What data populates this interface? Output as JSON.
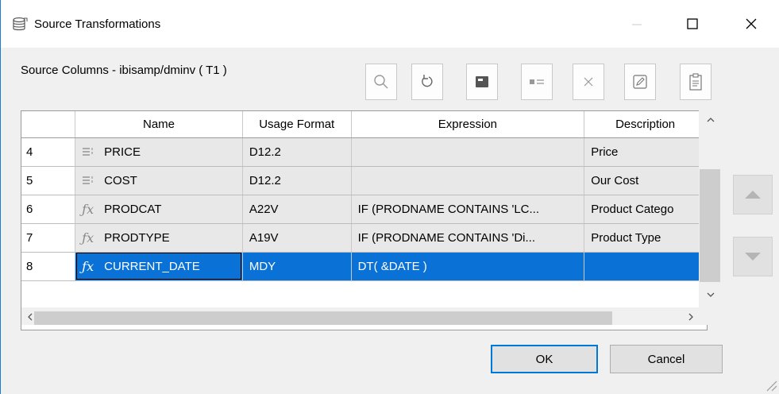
{
  "window": {
    "title": "Source Transformations",
    "icon": "database-icon"
  },
  "section_label": "Source Columns - ibisamp/dminv ( T1 )",
  "toolbar": [
    {
      "name": "search-button",
      "icon": "magnifier-icon"
    },
    {
      "name": "refresh-button",
      "icon": "refresh-icon"
    },
    {
      "name": "window-button",
      "icon": "window-icon"
    },
    {
      "name": "card-button",
      "icon": "card-icon"
    },
    {
      "name": "delete-button",
      "icon": "x-icon"
    },
    {
      "name": "edit-button",
      "icon": "pencil-icon"
    },
    {
      "name": "clipboard-button",
      "icon": "clipboard-icon"
    }
  ],
  "columns": [
    "Name",
    "Usage Format",
    "Expression",
    "Description"
  ],
  "rows": [
    {
      "num": "4",
      "icon": "field-icon",
      "name": "PRICE",
      "format": "D12.2",
      "expression": "",
      "description": "Price",
      "selected": false
    },
    {
      "num": "5",
      "icon": "field-icon",
      "name": "COST",
      "format": "D12.2",
      "expression": "",
      "description": "Our Cost",
      "selected": false
    },
    {
      "num": "6",
      "icon": "function-icon",
      "name": "PRODCAT",
      "format": "A22V",
      "expression": "IF (PRODNAME CONTAINS 'LC...",
      "description": "Product Catego",
      "selected": false
    },
    {
      "num": "7",
      "icon": "function-icon",
      "name": "PRODTYPE",
      "format": "A19V",
      "expression": "IF (PRODNAME CONTAINS 'Di...",
      "description": "Product Type",
      "selected": false
    },
    {
      "num": "8",
      "icon": "function-icon",
      "name": "CURRENT_DATE",
      "format": "MDY",
      "expression": "DT( &DATE )",
      "description": "",
      "selected": true
    }
  ],
  "buttons": {
    "ok": "OK",
    "cancel": "Cancel"
  },
  "colors": {
    "selection": "#0a72d6",
    "window_border": "#1c7cd5"
  }
}
